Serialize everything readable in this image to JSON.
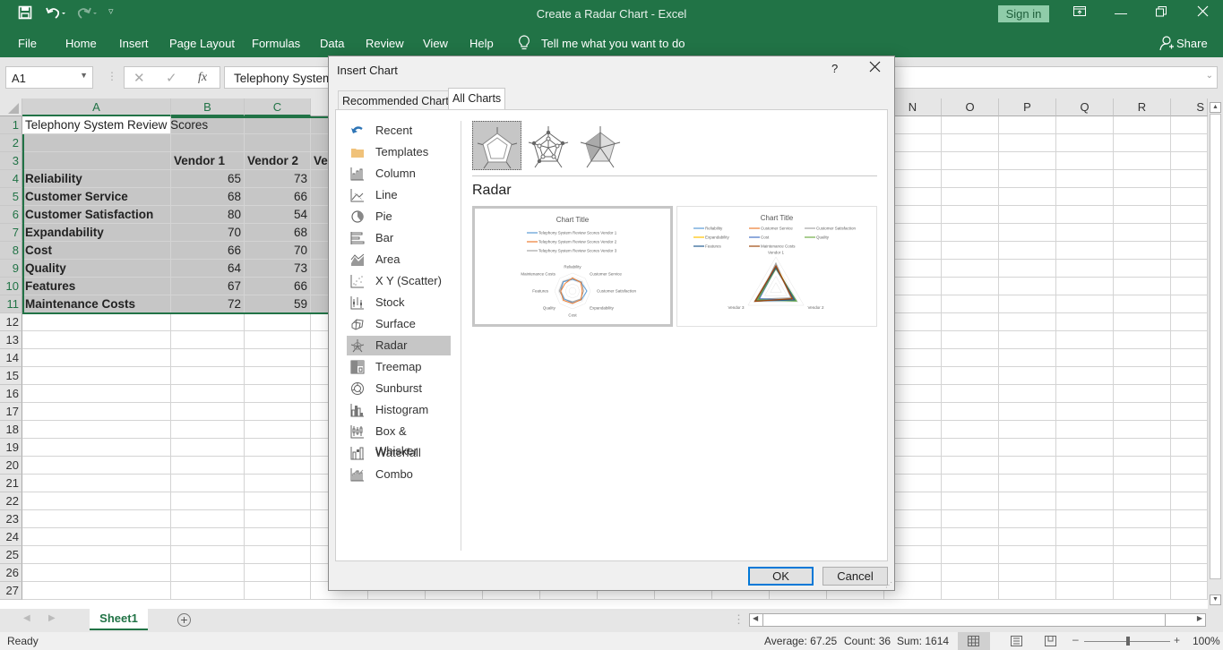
{
  "titlebar": {
    "title": "Create a Radar Chart  -  Excel",
    "sign_in": "Sign in",
    "icons": [
      "save-icon",
      "undo-icon",
      "redo-icon",
      "customize-qat-icon",
      "ribbon-display-icon",
      "minimize-icon",
      "restore-icon",
      "close-icon"
    ]
  },
  "ribbon": {
    "tabs": [
      "File",
      "Home",
      "Insert",
      "Page Layout",
      "Formulas",
      "Data",
      "Review",
      "View",
      "Help"
    ],
    "tell_me": "Tell me what you want to do",
    "share": "Share"
  },
  "formula_bar": {
    "name_box": "A1",
    "formula": "Telephony System Review Scores",
    "fx": "fx"
  },
  "sheet": {
    "columns": [
      "A",
      "B",
      "C",
      "N",
      "O",
      "P",
      "Q",
      "R",
      "S"
    ],
    "rows": [
      "1",
      "2",
      "3",
      "4",
      "5",
      "6",
      "7",
      "8",
      "9",
      "10",
      "11",
      "12",
      "13",
      "14",
      "15",
      "16",
      "17",
      "18",
      "19",
      "20",
      "21",
      "22",
      "23",
      "24",
      "25",
      "26",
      "27"
    ],
    "title": "Telephony System Review Scores",
    "header": [
      "",
      "Vendor 1",
      "Vendor 2",
      "Ve"
    ],
    "data": [
      {
        "label": "Reliability",
        "v1": "65",
        "v2": "73"
      },
      {
        "label": "Customer Service",
        "v1": "68",
        "v2": "66"
      },
      {
        "label": "Customer Satisfaction",
        "v1": "80",
        "v2": "54"
      },
      {
        "label": "Expandability",
        "v1": "70",
        "v2": "68"
      },
      {
        "label": "Cost",
        "v1": "66",
        "v2": "70"
      },
      {
        "label": "Quality",
        "v1": "64",
        "v2": "73"
      },
      {
        "label": "Features",
        "v1": "67",
        "v2": "66"
      },
      {
        "label": "Maintenance Costs",
        "v1": "72",
        "v2": "59"
      }
    ],
    "sheet_tab": "Sheet1"
  },
  "dialog": {
    "title": "Insert Chart",
    "help": "?",
    "tabs": [
      "Recommended Charts",
      "All Charts"
    ],
    "active_tab": "All Charts",
    "categories": [
      "Recent",
      "Templates",
      "Column",
      "Line",
      "Pie",
      "Bar",
      "Area",
      "X Y (Scatter)",
      "Stock",
      "Surface",
      "Radar",
      "Treemap",
      "Sunburst",
      "Histogram",
      "Box & Whisker",
      "Waterfall",
      "Combo"
    ],
    "selected_category": "Radar",
    "subtypes": [
      "Radar",
      "Radar with Markers",
      "Filled Radar"
    ],
    "section_title": "Radar",
    "preview1": {
      "title": "Chart Title",
      "legend": [
        "Telephony System Review Scores Vendor 1",
        "Telephony System Review Scores Vendor 2",
        "Telephony System Review Scores Vendor 3"
      ],
      "axes": [
        "Reliability",
        "Customer Service",
        "Customer Satisfaction",
        "Expandability",
        "Cost",
        "Quality",
        "Features",
        "Maintenance Costs"
      ]
    },
    "preview2": {
      "title": "Chart Title",
      "legend": [
        "Reliability",
        "Customer Service",
        "Customer Satisfaction",
        "Expandability",
        "Cost",
        "Quality",
        "Features",
        "Maintenance Costs"
      ],
      "axes": [
        "Vendor 1",
        "Vendor 2",
        "Vendor 3"
      ]
    },
    "ok": "OK",
    "cancel": "Cancel"
  },
  "status": {
    "ready": "Ready",
    "average": "Average: 67.25",
    "count": "Count: 36",
    "sum": "Sum: 1614",
    "zoom": "100%"
  },
  "colors": {
    "excel_green": "#217346",
    "vendor1": "#5b9bd5",
    "vendor2": "#ed7d31",
    "vendor3": "#a5a5a5"
  }
}
